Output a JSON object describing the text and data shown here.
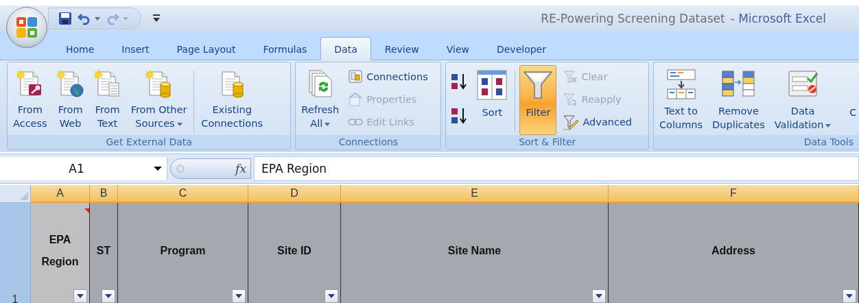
{
  "window": {
    "document_title": "RE-Powering Screening Dataset",
    "app_title": "- Microsoft Excel"
  },
  "quick_access": [
    {
      "disabled": false
    },
    {
      "disabled": false
    },
    {
      "disabled": true
    },
    {
      "disabled": false
    }
  ],
  "tabs": [
    {
      "label": "Home",
      "selected": false
    },
    {
      "label": "Insert",
      "selected": false
    },
    {
      "label": "Page Layout",
      "selected": false
    },
    {
      "label": "Formulas",
      "selected": false
    },
    {
      "label": "Data",
      "selected": true
    },
    {
      "label": "Review",
      "selected": false
    },
    {
      "label": "View",
      "selected": false
    },
    {
      "label": "Developer",
      "selected": false
    }
  ],
  "ribbon": [
    {
      "label": "Get External Data",
      "items": [
        {
          "kind": "large",
          "label": "From\nAccess",
          "selected": false,
          "dropdown": false
        },
        {
          "kind": "large",
          "label": "From\nWeb",
          "selected": false,
          "dropdown": false
        },
        {
          "kind": "large",
          "label": "From\nText",
          "selected": false,
          "dropdown": false
        },
        {
          "kind": "large",
          "label": "From Other\nSources",
          "selected": false,
          "dropdown": true
        },
        {
          "kind": "separator"
        },
        {
          "kind": "large",
          "label": "Existing\nConnections",
          "selected": false,
          "dropdown": false
        }
      ]
    },
    {
      "label": "Connections",
      "items": [
        {
          "kind": "large",
          "label": "Refresh\nAll",
          "selected": false,
          "dropdown": true
        },
        {
          "kind": "stack",
          "items": [
            {
              "kind": "small",
              "label": "Connections",
              "disabled": false
            },
            {
              "kind": "small",
              "label": "Properties",
              "disabled": true
            },
            {
              "kind": "small",
              "label": "Edit Links",
              "disabled": true
            }
          ]
        }
      ]
    },
    {
      "label": "Sort & Filter",
      "items": [
        {
          "kind": "stack",
          "items": [
            {
              "kind": "icon",
              "disabled": false
            },
            {
              "kind": "icon",
              "disabled": false
            }
          ]
        },
        {
          "kind": "large",
          "label": "Sort",
          "selected": false,
          "dropdown": false
        },
        {
          "kind": "separator"
        },
        {
          "kind": "large",
          "label": "Filter",
          "selected": true,
          "dropdown": false
        },
        {
          "kind": "stack",
          "items": [
            {
              "kind": "small",
              "label": "Clear",
              "disabled": true
            },
            {
              "kind": "small",
              "label": "Reapply",
              "disabled": true
            },
            {
              "kind": "small",
              "label": "Advanced",
              "disabled": false
            }
          ]
        }
      ]
    },
    {
      "label": "Data Tools",
      "items": [
        {
          "kind": "large",
          "label": "Text to\nColumns",
          "selected": false,
          "dropdown": false
        },
        {
          "kind": "large",
          "label": "Remove\nDuplicates",
          "selected": false,
          "dropdown": false
        },
        {
          "kind": "large",
          "label": "Data\nValidation",
          "selected": false,
          "dropdown": true
        },
        {
          "kind": "large",
          "label": "C",
          "selected": false,
          "dropdown": false
        }
      ]
    }
  ],
  "formula_bar": {
    "name_box": "A1",
    "function_label": "fx",
    "value": "EPA Region"
  },
  "grid": {
    "row_label": "1",
    "columns": [
      {
        "label": "A",
        "selected": true
      },
      {
        "label": "B",
        "selected": true
      },
      {
        "label": "C",
        "selected": true
      },
      {
        "label": "D",
        "selected": true
      },
      {
        "label": "E",
        "selected": true
      },
      {
        "label": "F",
        "selected": true
      }
    ],
    "cells": [
      {
        "text": "EPA Region",
        "selected": true,
        "comment": true,
        "filter": true
      },
      {
        "text": "ST",
        "selected": false,
        "comment": false,
        "filter": true
      },
      {
        "text": "Program",
        "selected": false,
        "comment": false,
        "filter": true
      },
      {
        "text": "Site ID",
        "selected": false,
        "comment": false,
        "filter": true
      },
      {
        "text": "Site Name",
        "selected": false,
        "comment": false,
        "filter": true
      },
      {
        "text": "Address",
        "selected": false,
        "comment": false,
        "filter": true
      }
    ]
  }
}
